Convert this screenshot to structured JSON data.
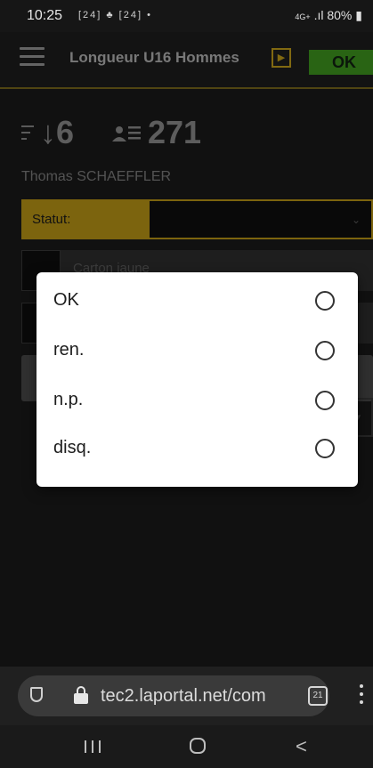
{
  "status_bar": {
    "time": "10:25",
    "notif_icons": "[24] ♣ [24] •",
    "signal_text": "4G+",
    "battery": "80%"
  },
  "app_bar": {
    "title": "Longueur  U16 Hommes",
    "play_icon": "play-square-icon",
    "ok_label": "OK",
    "accent_color": "#bf9a16",
    "ok_color": "#3f9a1f"
  },
  "athlete_info": {
    "order": "6",
    "bib": "271",
    "name": "Thomas SCHAEFFLER"
  },
  "form": {
    "statut_label": "Statut:",
    "statut_value": "",
    "carton_placeholder": "Carton jaune"
  },
  "status_dialog": {
    "options": [
      {
        "label": "OK",
        "selected": false
      },
      {
        "label": "ren.",
        "selected": false
      },
      {
        "label": "n.p.",
        "selected": false
      },
      {
        "label": "disq.",
        "selected": false
      }
    ]
  },
  "browser": {
    "url": "tec2.laportal.net/com",
    "tab_count": "21"
  }
}
